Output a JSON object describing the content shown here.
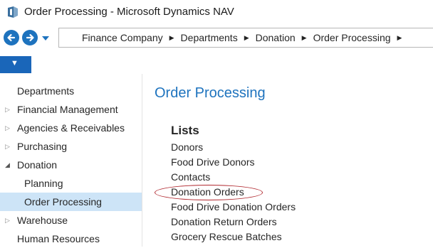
{
  "window": {
    "title": "Order Processing - Microsoft Dynamics NAV",
    "app_icon": "dynamics-nav-icon"
  },
  "navigation": {
    "back_icon": "back-arrow-icon",
    "forward_icon": "forward-arrow-icon",
    "history_icon": "chevron-down-icon",
    "breadcrumbs": [
      "Finance Company",
      "Departments",
      "Donation",
      "Order Processing"
    ],
    "separator": "▶"
  },
  "ribbon": {
    "toggle_glyph": "▼"
  },
  "sidebar": {
    "items": [
      {
        "label": "Departments",
        "arrow": ""
      },
      {
        "label": "Financial Management",
        "arrow": "▷"
      },
      {
        "label": "Agencies & Receivables",
        "arrow": "▷"
      },
      {
        "label": "Purchasing",
        "arrow": "▷"
      },
      {
        "label": "Donation",
        "arrow": "◢"
      },
      {
        "label": "Planning",
        "arrow": ""
      },
      {
        "label": "Order Processing",
        "arrow": ""
      },
      {
        "label": "Warehouse",
        "arrow": "▷"
      },
      {
        "label": "Human Resources",
        "arrow": ""
      }
    ]
  },
  "main": {
    "title": "Order Processing",
    "section": "Lists",
    "links": [
      "Donors",
      "Food Drive Donors",
      "Contacts",
      "Donation Orders",
      "Food Drive Donation Orders",
      "Donation Return Orders",
      "Grocery Rescue Batches"
    ]
  },
  "colors": {
    "accent_blue": "#1e73be",
    "selection_bg": "#cde4f7",
    "highlight_ring": "#b0262d"
  }
}
